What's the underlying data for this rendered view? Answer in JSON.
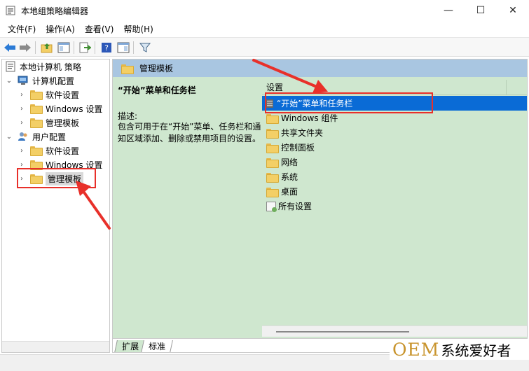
{
  "window": {
    "title": "本地组策略编辑器",
    "controls": {
      "minimize": "—",
      "maximize": "☐",
      "close": "✕"
    }
  },
  "menu": [
    "文件(F)",
    "操作(A)",
    "查看(V)",
    "帮助(H)"
  ],
  "toolbar": {
    "icons": [
      "back-arrow-icon",
      "forward-arrow-icon",
      "up-folder-icon",
      "show-hide-tree-icon",
      "export-list-icon",
      "help-icon",
      "properties-pane-icon",
      "filter-icon"
    ]
  },
  "tree": {
    "root": "本地计算机 策略",
    "computer_config": "计算机配置",
    "computer_children": [
      "软件设置",
      "Windows 设置",
      "管理模板"
    ],
    "user_config": "用户配置",
    "user_children": [
      "软件设置",
      "Windows 设置",
      "管理模板"
    ]
  },
  "content": {
    "header": "管理模板",
    "selected_title": "“开始”菜单和任务栏",
    "desc_label": "描述:",
    "desc_text": "包含可用于在“开始”菜单、任务栏和通知区域添加、删除或禁用项目的设置。",
    "column_header": "设置",
    "items": [
      {
        "label": "“开始”菜单和任务栏",
        "icon": "setting-icon",
        "selected": true
      },
      {
        "label": "Windows 组件",
        "icon": "folder-icon"
      },
      {
        "label": "共享文件夹",
        "icon": "folder-icon"
      },
      {
        "label": "控制面板",
        "icon": "folder-icon"
      },
      {
        "label": "网络",
        "icon": "folder-icon"
      },
      {
        "label": "系统",
        "icon": "folder-icon"
      },
      {
        "label": "桌面",
        "icon": "folder-icon"
      },
      {
        "label": "所有设置",
        "icon": "all-settings-icon"
      }
    ]
  },
  "tabs": [
    "扩展",
    "标准"
  ],
  "watermark": {
    "brand": "OEM",
    "suffix": "系统爱好者"
  },
  "colors": {
    "selection": "#0a6bd6",
    "pane_bg": "#cfe7cf",
    "header_bg": "#a9c6e1",
    "annotation": "#e8302a"
  }
}
